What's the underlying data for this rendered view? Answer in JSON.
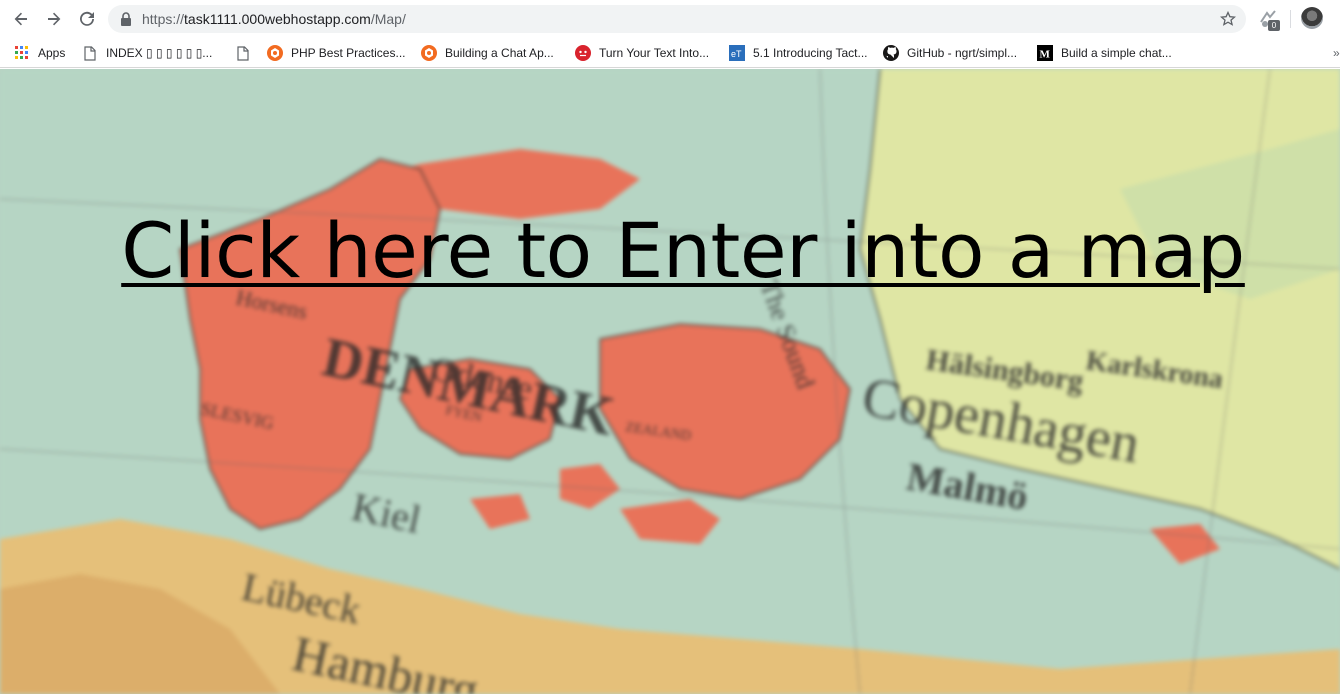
{
  "browser": {
    "url_scheme": "https://",
    "url_host": "task1111.000webhostapp.com",
    "url_path": "/Map/",
    "extension_badge": "0"
  },
  "bookmarks": [
    {
      "label": "Apps",
      "icon": "apps-grid-icon"
    },
    {
      "label": "INDEX ▯ ▯ ▯ ▯ ▯ ▯...",
      "icon": "page-icon"
    },
    {
      "label": "",
      "icon": "page-icon"
    },
    {
      "label": "PHP Best Practices...",
      "icon": "orange-hexagon-icon"
    },
    {
      "label": "Building a Chat Ap...",
      "icon": "orange-hexagon-icon"
    },
    {
      "label": "Turn Your Text Into...",
      "icon": "red-circle-icon"
    },
    {
      "label": "5.1 Introducing Tact...",
      "icon": "blue-square-icon"
    },
    {
      "label": "GitHub - ngrt/simpl...",
      "icon": "github-icon"
    },
    {
      "label": "Build a simple chat...",
      "icon": "medium-icon"
    }
  ],
  "main": {
    "link_text": "Click here to Enter into a map"
  },
  "map_labels": {
    "denmark": "DENMARK",
    "odense": "Odense",
    "fyen": "FYEN",
    "zealand": "ZEALAND",
    "sound": "The Sound",
    "copenhagen": "Copenhagen",
    "malmo": "Malmö",
    "halsingborg": "Hälsingborg",
    "karlskrona": "Karlskrona",
    "kiel": "Kiel",
    "horsens": "Horsens",
    "hamburg": "Hamburg",
    "lubeck": "Lübeck",
    "slesvig": "SLESVIG"
  },
  "colors": {
    "land_red": "#e8735a",
    "sea": "#b9d6c6",
    "sweden": "#dfe7a6",
    "germany": "#e8c27a"
  }
}
